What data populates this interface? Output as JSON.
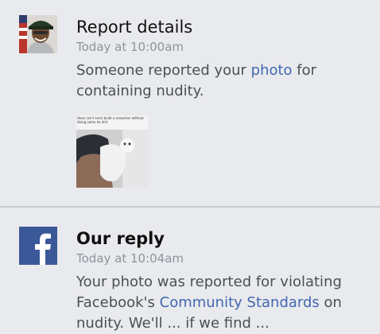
{
  "report": {
    "title": "Report details",
    "time": "Today at 10:00am",
    "body_prefix": "Someone reported your ",
    "body_link": "photo",
    "body_suffix": " for containing nudity.",
    "thumbnail_caption": "Hoes can't even build a snowman without doing some ho shit"
  },
  "reply": {
    "title": "Our reply",
    "time": "Today at 10:04am",
    "body_prefix": "Your photo was reported for violating Facebook's ",
    "body_link": "Community Standards",
    "body_suffix": " on nudity. We'll ... if we find ..."
  },
  "colors": {
    "background": "#e9eaed",
    "link": "#4267b2",
    "facebook_blue": "#3b5998",
    "timestamp": "#8d949e"
  },
  "icons": {
    "reply_logo": "facebook-f-icon"
  }
}
